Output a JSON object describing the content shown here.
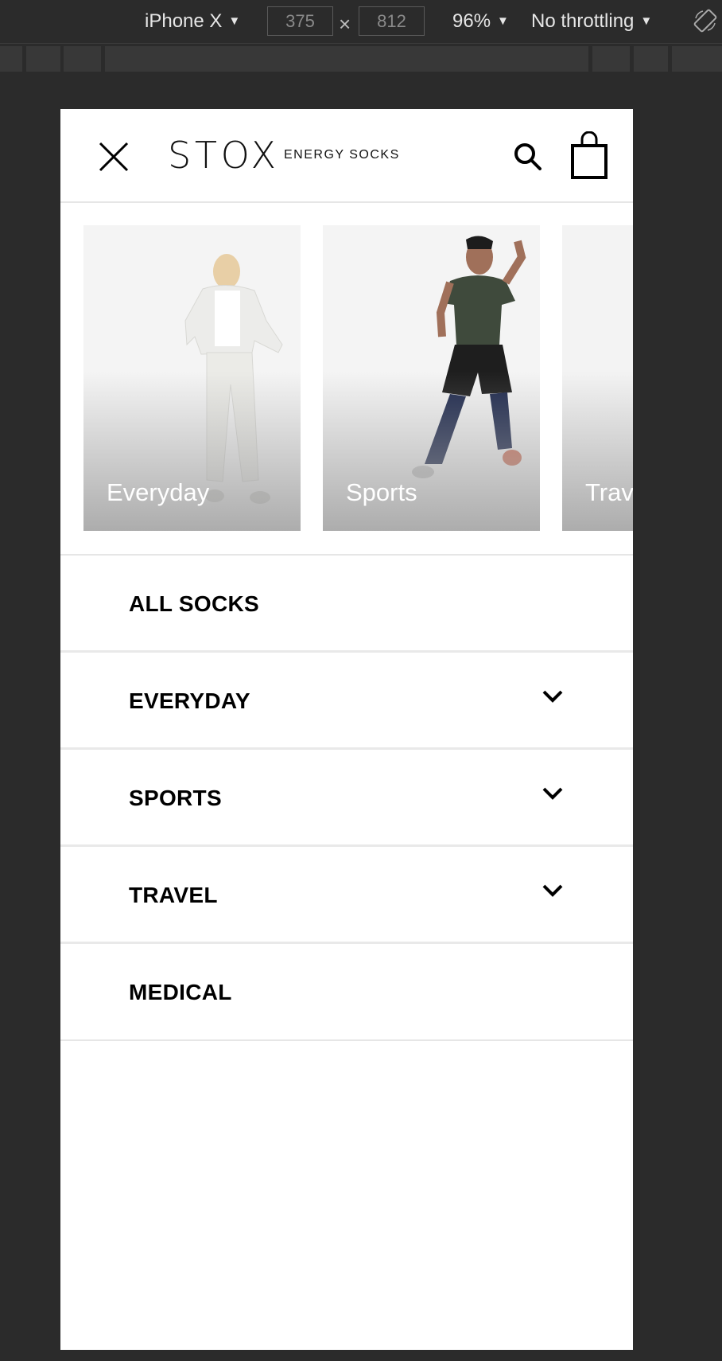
{
  "devtools": {
    "device": "iPhone X",
    "width": "375",
    "height": "812",
    "size_separator": "×",
    "zoom": "96%",
    "throttling": "No throttling",
    "caret": "▼"
  },
  "header": {
    "logo_main": "STOX",
    "logo_sub": "ENERGY SOCKS",
    "icons": [
      "close-icon",
      "search-icon",
      "shopping-bag-icon"
    ]
  },
  "categories": [
    {
      "label": "Everyday"
    },
    {
      "label": "Sports"
    },
    {
      "label": "Trav"
    }
  ],
  "menu": {
    "items": [
      {
        "label": "ALL SOCKS",
        "expandable": false
      },
      {
        "label": "EVERYDAY",
        "expandable": true
      },
      {
        "label": "SPORTS",
        "expandable": true
      },
      {
        "label": "TRAVEL",
        "expandable": true
      },
      {
        "label": "MEDICAL",
        "expandable": false
      }
    ]
  },
  "colors": {
    "devtools_bg": "#2b2b2b",
    "page_bg": "#ffffff",
    "divider": "#e6e6e6",
    "text": "#000000"
  }
}
